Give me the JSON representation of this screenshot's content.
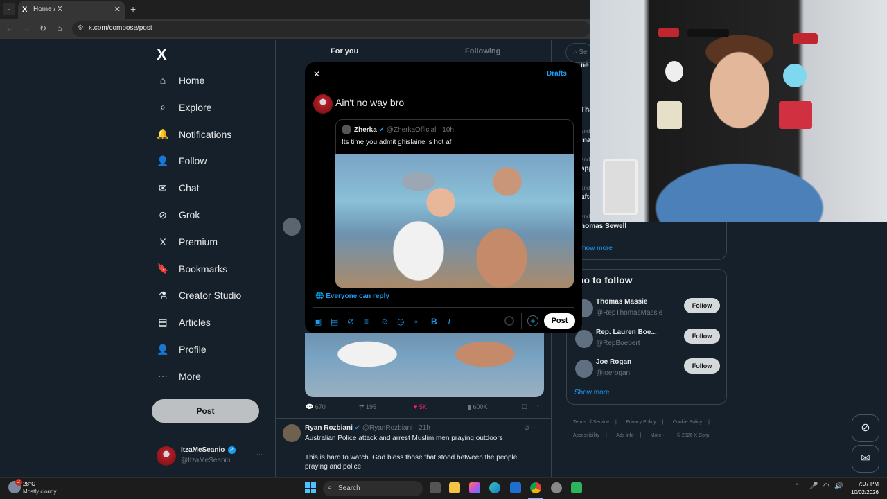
{
  "browser": {
    "tab_title": "Home / X",
    "tab_menu": "⌄",
    "tab_favicon": "X",
    "tab_close": "✕",
    "new_tab": "+",
    "url": "x.com/compose/post"
  },
  "sidebar": {
    "logo": "X",
    "items": [
      {
        "label": "Home",
        "icon": "home-icon"
      },
      {
        "label": "Explore",
        "icon": "search-icon"
      },
      {
        "label": "Notifications",
        "icon": "bell-icon"
      },
      {
        "label": "Follow",
        "icon": "person-plus-icon"
      },
      {
        "label": "Chat",
        "icon": "mail-icon"
      },
      {
        "label": "Grok",
        "icon": "grok-icon"
      },
      {
        "label": "Premium",
        "icon": "x-icon"
      },
      {
        "label": "Bookmarks",
        "icon": "bookmark-icon"
      },
      {
        "label": "Creator Studio",
        "icon": "flask-icon"
      },
      {
        "label": "Articles",
        "icon": "article-icon"
      },
      {
        "label": "Profile",
        "icon": "person-icon"
      },
      {
        "label": "More",
        "icon": "more-circle-icon"
      }
    ],
    "post_label": "Post",
    "account": {
      "name": "ItzaMeSeanio",
      "handle": "@ItzaMeSeanio",
      "more": "..."
    }
  },
  "center": {
    "tab_for_you": "For you",
    "tab_following": "Following"
  },
  "composer": {
    "close": "✕",
    "drafts": "Drafts",
    "text": "Ain't no way bro",
    "quote": {
      "name": "Zherka",
      "handle": "@ZherkaOfficial",
      "time": "· 10h",
      "text": "Its time you admit ghislaine is hot af"
    },
    "reply_setting": "Everyone can reply",
    "post_label": "Post"
  },
  "feed": {
    "metrics": {
      "replies": "670",
      "reposts": "195",
      "likes": "5K",
      "views": "600K"
    },
    "post": {
      "name": "Ryan Rozbiani",
      "handle": "@RyanRozbiani",
      "time": "· 21h",
      "line1": "Australian Police attack and arrest Muslim men praying outdoors",
      "line2": "This is hard to watch. God bless those that stood between the people praying and police."
    }
  },
  "right": {
    "search_frag": "Se",
    "trend_frags": [
      "ne",
      "Tha",
      "and",
      "ma",
      "and",
      "app",
      "and",
      "afte",
      "and"
    ],
    "thomas_sewell": "homas Sewell",
    "show_more_1": "how more",
    "wtf_title": "ho to follow",
    "who_to_follow": [
      {
        "name": "Thomas Massie",
        "handle": "@RepThomasMassie"
      },
      {
        "name": "Rep. Lauren Boe...",
        "handle": "@RepBoebert"
      },
      {
        "name": "Joe Rogan",
        "handle": "@joerogan"
      }
    ],
    "follow_label": "Follow",
    "show_more_2": "Show more",
    "footer": [
      "Terms of Service",
      "|",
      "Privacy Policy",
      "|",
      "Cookie Policy",
      "|",
      "Accessibility",
      "|",
      "Ads info",
      "|",
      "More ···",
      "© 2026 X Corp."
    ]
  },
  "taskbar": {
    "weather_temp": "28°C",
    "weather_desc": "Mostly cloudy",
    "weather_badge": "2",
    "search_label": "Search",
    "time": "7:07 PM",
    "date": "10/02/2026"
  },
  "colors": {
    "accent": "#1d9bf0",
    "bg": "#15202b",
    "modal": "#000000",
    "like": "#f91880"
  }
}
